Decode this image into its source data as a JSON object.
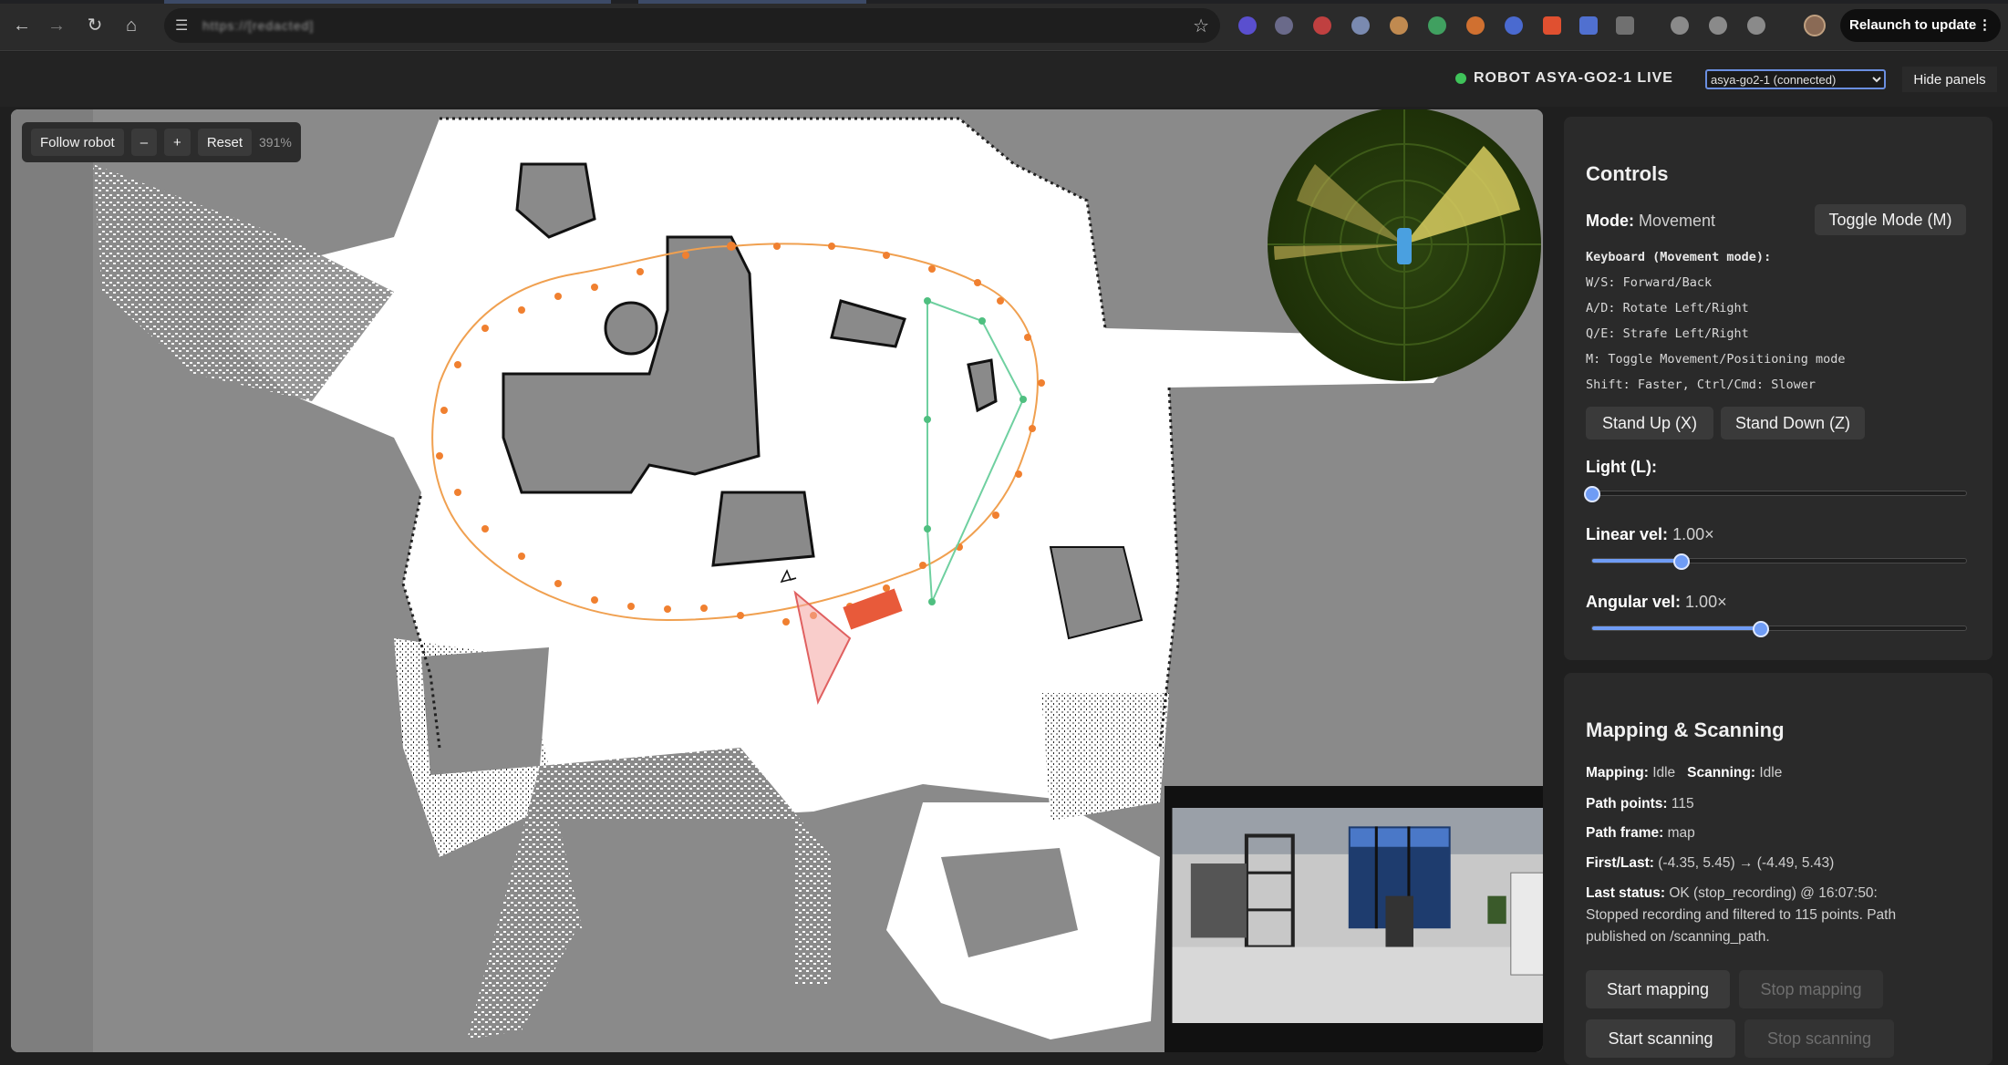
{
  "browser": {
    "url_obscured": "https://[redacted]",
    "relaunch_label": "Relaunch to update",
    "menu_label": "⋮"
  },
  "header": {
    "robot_status": "ROBOT ASYA-GO2-1 LIVE",
    "robot_selector_value": "asya-go2-1 (connected)",
    "hide_panels_label": "Hide panels",
    "status_color": "#3fc35a"
  },
  "map": {
    "follow_label": "Follow robot",
    "zoom_out_label": "–",
    "zoom_in_label": "+",
    "reset_label": "Reset",
    "zoom_level": "391%",
    "path_color": "#f0a050",
    "route_color": "#6fd0a0",
    "robot_color": "#e85a3a"
  },
  "controls": {
    "title": "Controls",
    "mode_label": "Mode:",
    "mode_value": "Movement",
    "toggle_mode_label": "Toggle Mode (M)",
    "keyboard_heading": "Keyboard (Movement mode):",
    "keyboard_lines": [
      "W/S: Forward/Back",
      "A/D: Rotate Left/Right",
      "Q/E: Strafe Left/Right",
      "M: Toggle Movement/Positioning mode",
      "Shift: Faster, Ctrl/Cmd: Slower"
    ],
    "stand_up_label": "Stand Up (X)",
    "stand_down_label": "Stand Down (Z)",
    "light_label": "Light (L):",
    "light_value": 0,
    "linear_label": "Linear vel:",
    "linear_value": "1.00×",
    "linear_fraction": 0.24,
    "angular_label": "Angular vel:",
    "angular_value": "1.00×",
    "angular_fraction": 0.45
  },
  "mapping": {
    "title": "Mapping & Scanning",
    "mapping_label": "Mapping:",
    "mapping_value": "Idle",
    "scanning_label": "Scanning:",
    "scanning_value": "Idle",
    "path_points_label": "Path points:",
    "path_points_value": "115",
    "path_frame_label": "Path frame:",
    "path_frame_value": "map",
    "first_last_label": "First/Last:",
    "first_last_value": "(-4.35, 5.45) → (-4.49, 5.43)",
    "last_status_label": "Last status:",
    "last_status_line1": "OK (stop_recording) @ 16:07:50:",
    "last_status_line2": "Stopped recording and filtered to 115 points. Path",
    "last_status_line3": "published on /scanning_path.",
    "start_mapping_label": "Start mapping",
    "stop_mapping_label": "Stop mapping",
    "start_scanning_label": "Start scanning",
    "stop_scanning_label": "Stop scanning"
  }
}
